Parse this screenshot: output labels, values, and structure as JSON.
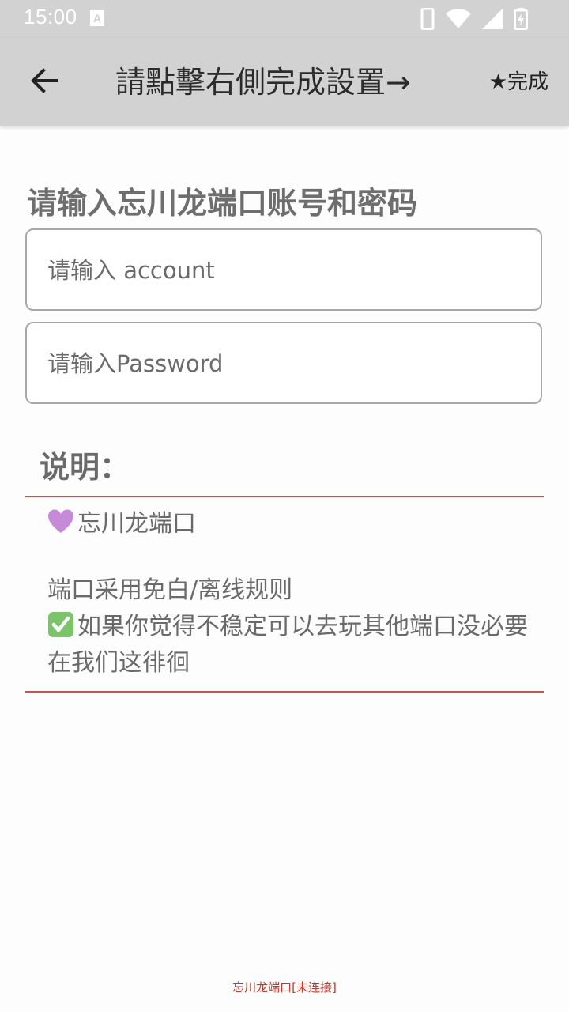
{
  "status_bar": {
    "time": "15:00",
    "notification_icon": "text-a-notification-icon",
    "icons": [
      "phone-icon",
      "wifi-icon",
      "signal-icon",
      "battery-charging-icon"
    ],
    "icon_color": "#ffffff",
    "background": "#d2d2d2"
  },
  "app_bar": {
    "back_icon": "arrow-left-icon",
    "title": "請點擊右側完成設置→",
    "done_label": "★完成"
  },
  "form": {
    "heading": "请输入忘川龙端口账号和密码",
    "account_placeholder": "请输入 account",
    "account_value": "",
    "password_placeholder": "请输入Password",
    "password_value": ""
  },
  "description": {
    "title": "说明：",
    "line1": "忘川龙端口",
    "line2": "端口采用免白/离线规则",
    "line3": "如果你觉得不稳定可以去玩其他端口没必要在我们这徘徊",
    "divider_color": "#c9544f"
  },
  "footer": {
    "status_text": "忘川龙端口[未连接]",
    "color": "#c0392b"
  }
}
